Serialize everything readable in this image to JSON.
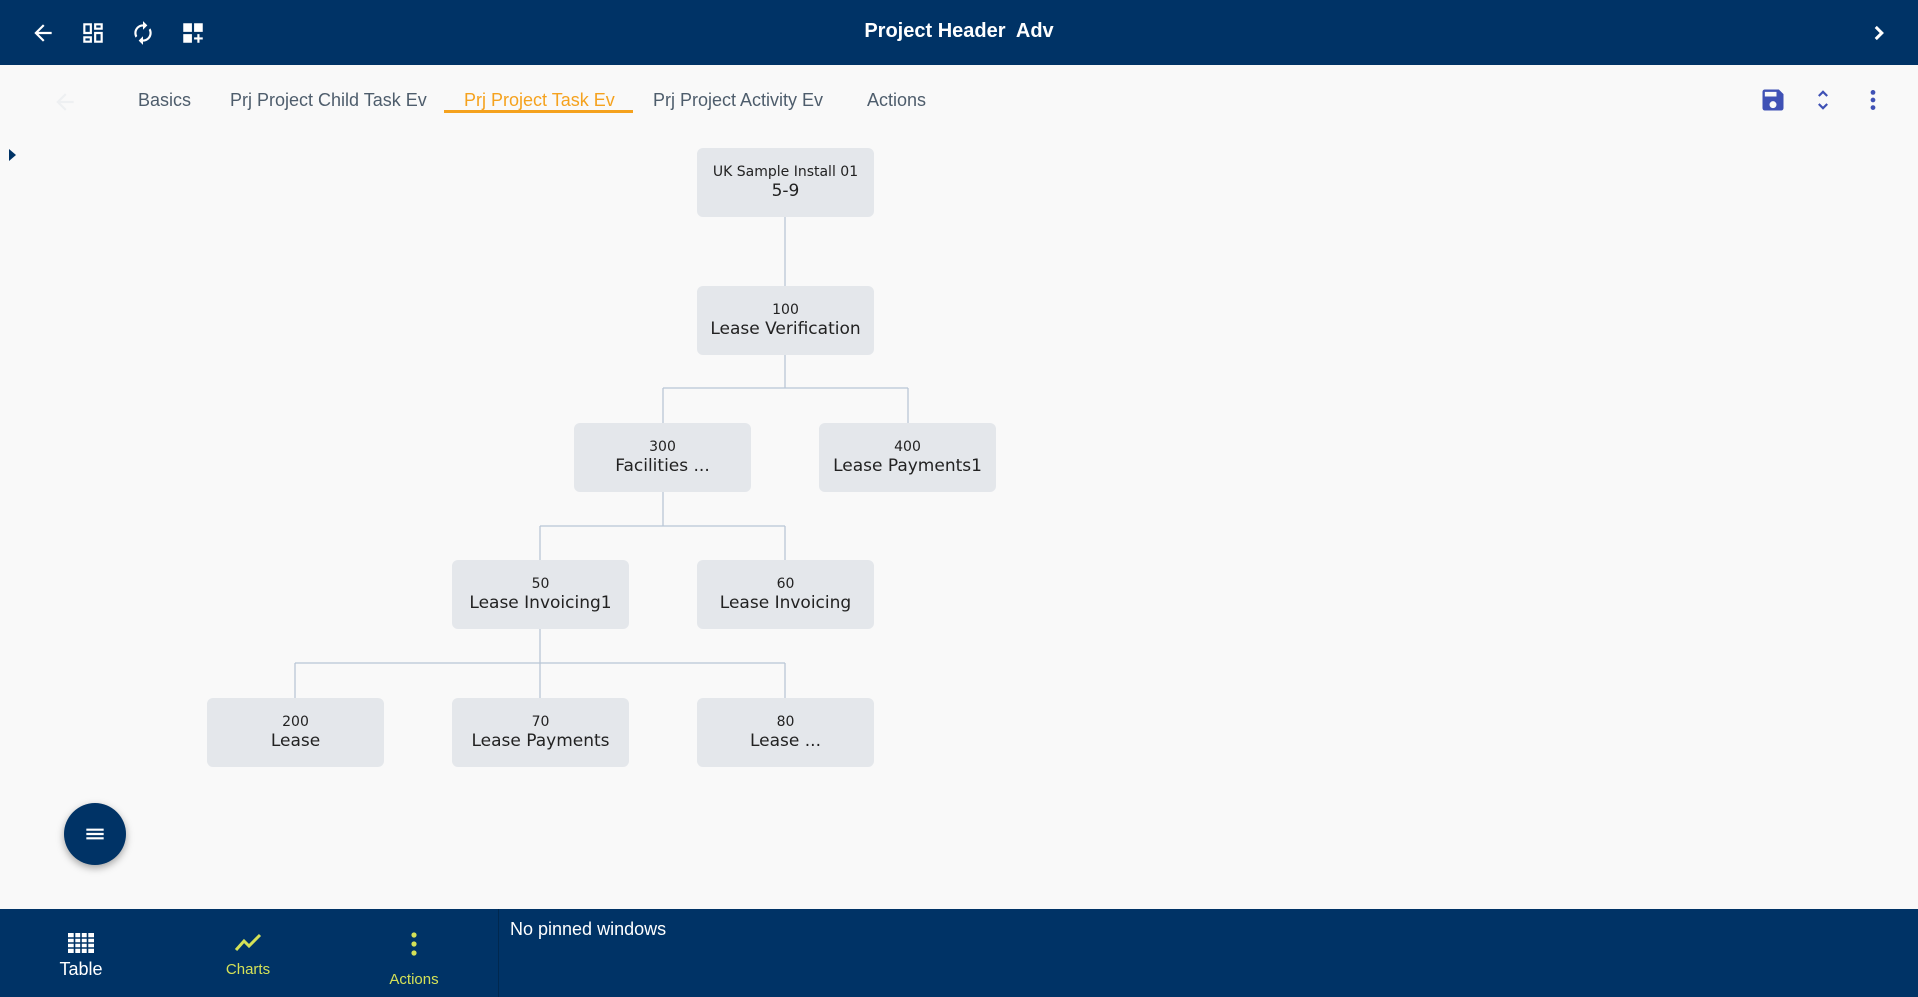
{
  "header": {
    "title": "Project Header  Adv",
    "icons": [
      "back-arrow-icon",
      "dashboard-icon",
      "refresh-icon",
      "add-widget-icon",
      "chevron-right-icon"
    ]
  },
  "tabs": [
    {
      "label": "Basics",
      "active": false
    },
    {
      "label": "Prj Project Child Task Ev",
      "active": false
    },
    {
      "label": "Prj Project Task Ev",
      "active": true
    },
    {
      "label": "Prj Project Activity Ev",
      "active": false
    },
    {
      "label": "Actions",
      "active": false
    }
  ],
  "toolbar_icons": [
    "save-icon",
    "expand-collapse-icon",
    "more-vert-icon"
  ],
  "tree": {
    "root": {
      "top": "UK Sample Install 01",
      "bottom": "5-9"
    },
    "level1": [
      {
        "top": "100",
        "bottom": "Lease Verification"
      }
    ],
    "level2": [
      {
        "top": "300",
        "bottom": "Facilities ..."
      },
      {
        "top": "400",
        "bottom": "Lease Payments1"
      }
    ],
    "level3": [
      {
        "top": "50",
        "bottom": "Lease Invoicing1"
      },
      {
        "top": "60",
        "bottom": "Lease Invoicing"
      }
    ],
    "level4": [
      {
        "top": "200",
        "bottom": "Lease"
      },
      {
        "top": "70",
        "bottom": "Lease Payments"
      },
      {
        "top": "80",
        "bottom": "Lease ..."
      }
    ]
  },
  "fab": {
    "icon": "menu-icon"
  },
  "bottom_nav": [
    {
      "label": "Table",
      "icon": "table-icon",
      "color": "#ffffff"
    },
    {
      "label": "Charts",
      "icon": "chart-line-icon",
      "color": "#d4e157"
    },
    {
      "label": "Actions",
      "icon": "more-vert-icon",
      "color": "#d4e157"
    }
  ],
  "pinned_text": "No pinned windows",
  "colors": {
    "primary": "#003366",
    "accent": "#f5a21e",
    "node_bg": "#e4e7eb",
    "connector": "#b9c6d6",
    "save_icon": "#3f51b5",
    "nav_active": "#d4e157"
  }
}
